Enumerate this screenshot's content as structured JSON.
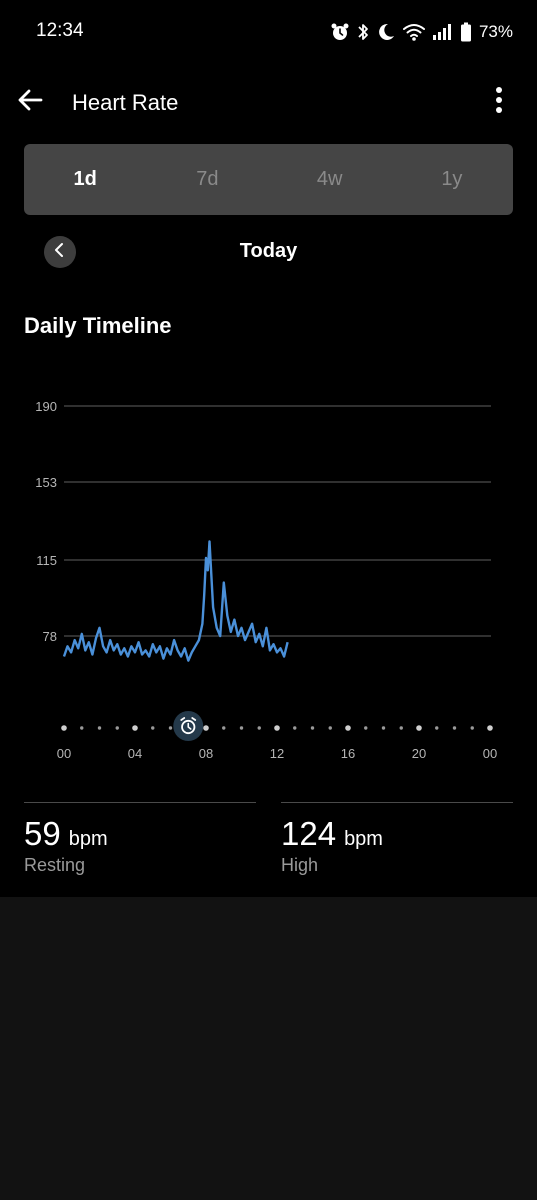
{
  "status_bar": {
    "time": "12:34",
    "battery": "73%"
  },
  "app_bar": {
    "title": "Heart Rate"
  },
  "range_tabs": [
    {
      "label": "1d",
      "active": true
    },
    {
      "label": "7d",
      "active": false
    },
    {
      "label": "4w",
      "active": false
    },
    {
      "label": "1y",
      "active": false
    }
  ],
  "period": {
    "label": "Today"
  },
  "section": {
    "title": "Daily Timeline"
  },
  "chart_data": {
    "type": "line",
    "ylim": [
      40,
      190
    ],
    "yticks": [
      190,
      153,
      115,
      78
    ],
    "xlim": [
      0,
      24
    ],
    "xticks": [
      0,
      4,
      8,
      12,
      16,
      20,
      24
    ],
    "xtick_labels": [
      "00",
      "04",
      "08",
      "12",
      "16",
      "20",
      "00"
    ],
    "grid": true,
    "line_color": "#4a90d9",
    "marker": {
      "x": 7.0,
      "icon": "alarm-clock-icon"
    },
    "series": [
      {
        "x": [
          0.0,
          0.2,
          0.4,
          0.6,
          0.8,
          1.0,
          1.2,
          1.4,
          1.6,
          1.8,
          2.0,
          2.2,
          2.4,
          2.6,
          2.8,
          3.0,
          3.2,
          3.4,
          3.6,
          3.8,
          4.0,
          4.2,
          4.4,
          4.6,
          4.8,
          5.0,
          5.2,
          5.4,
          5.6,
          5.8,
          6.0,
          6.2,
          6.4,
          6.6,
          6.8,
          7.0,
          7.2,
          7.4,
          7.6,
          7.8,
          7.9,
          8.0,
          8.1,
          8.2,
          8.4,
          8.6,
          8.8,
          9.0,
          9.2,
          9.4,
          9.6,
          9.8,
          10.0,
          10.2,
          10.4,
          10.6,
          10.8,
          11.0,
          11.2,
          11.4,
          11.6,
          11.8,
          12.0,
          12.2,
          12.4,
          12.6
        ],
        "y": [
          68,
          73,
          70,
          76,
          72,
          79,
          71,
          75,
          69,
          77,
          82,
          73,
          70,
          76,
          71,
          74,
          69,
          72,
          68,
          73,
          70,
          75,
          69,
          71,
          68,
          74,
          70,
          73,
          67,
          72,
          69,
          76,
          71,
          68,
          72,
          66,
          70,
          73,
          76,
          84,
          98,
          116,
          110,
          124,
          92,
          82,
          78,
          104,
          88,
          80,
          86,
          78,
          82,
          76,
          80,
          84,
          75,
          79,
          73,
          82,
          71,
          74,
          70,
          72,
          68,
          75
        ]
      }
    ]
  },
  "stats": {
    "resting": {
      "value": "59",
      "unit": "bpm",
      "label": "Resting"
    },
    "high": {
      "value": "124",
      "unit": "bpm",
      "label": "High"
    }
  }
}
